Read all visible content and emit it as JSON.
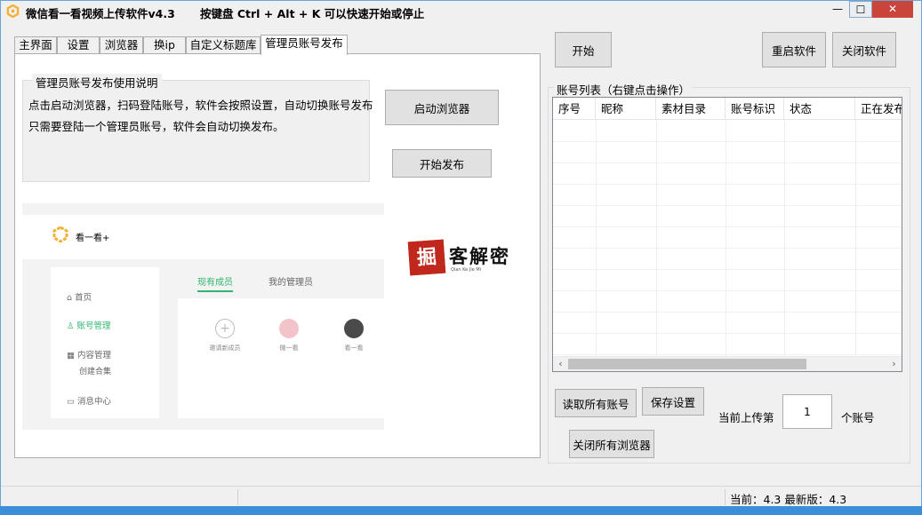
{
  "window": {
    "title": "微信看一看视频上传软件v4.3",
    "hint": "按键盘 Ctrl + Alt + K  可以快速开始或停止",
    "min_glyph": "—",
    "max_glyph": "☐",
    "close_glyph": "✕"
  },
  "tabs": [
    "主界面",
    "设置",
    "浏览器",
    "换ip",
    "自定义标题库",
    "管理员账号发布"
  ],
  "instructions": {
    "title": "管理员账号发布使用说明",
    "line1": "点击启动浏览器，扫码登陆账号，软件会按照设置，自动切换账号发布",
    "line2": "只需要登陆一个管理员账号，软件会自动切换发布。"
  },
  "buttons": {
    "launch_browser": "启动浏览器",
    "start_publish": "开始发布",
    "start": "开始",
    "restart": "重启软件",
    "close_app": "关闭软件",
    "read_accounts": "读取所有账号",
    "save_settings": "保存设置",
    "close_browsers": "关闭所有浏览器"
  },
  "preview": {
    "brand": "看一看+",
    "nav": [
      "首页",
      "账号管理",
      "内容管理",
      "创建合集",
      "消息中心"
    ],
    "nav_icons": [
      "home-icon",
      "user-icon",
      "grid-icon",
      "",
      "message-icon"
    ],
    "tabs": [
      "现有成员",
      "我的管理员"
    ],
    "invite_label": "邀请新成员",
    "member1_label": "微一看",
    "member2_label": "看一看",
    "accent_color": "#2fb56e"
  },
  "watermark": {
    "seal": "掘",
    "text": "客解密",
    "sub": "Qian Ke Jie Mi"
  },
  "account_list": {
    "title": "账号列表（右键点击操作）",
    "columns": [
      "序号",
      "昵称",
      "素材目录",
      "账号标识",
      "状态",
      "正在发布"
    ]
  },
  "upload": {
    "prefix": "当前上传第",
    "value": "1",
    "suffix": "个账号"
  },
  "status": {
    "text": "当前：4.3    最新版：4.3"
  }
}
